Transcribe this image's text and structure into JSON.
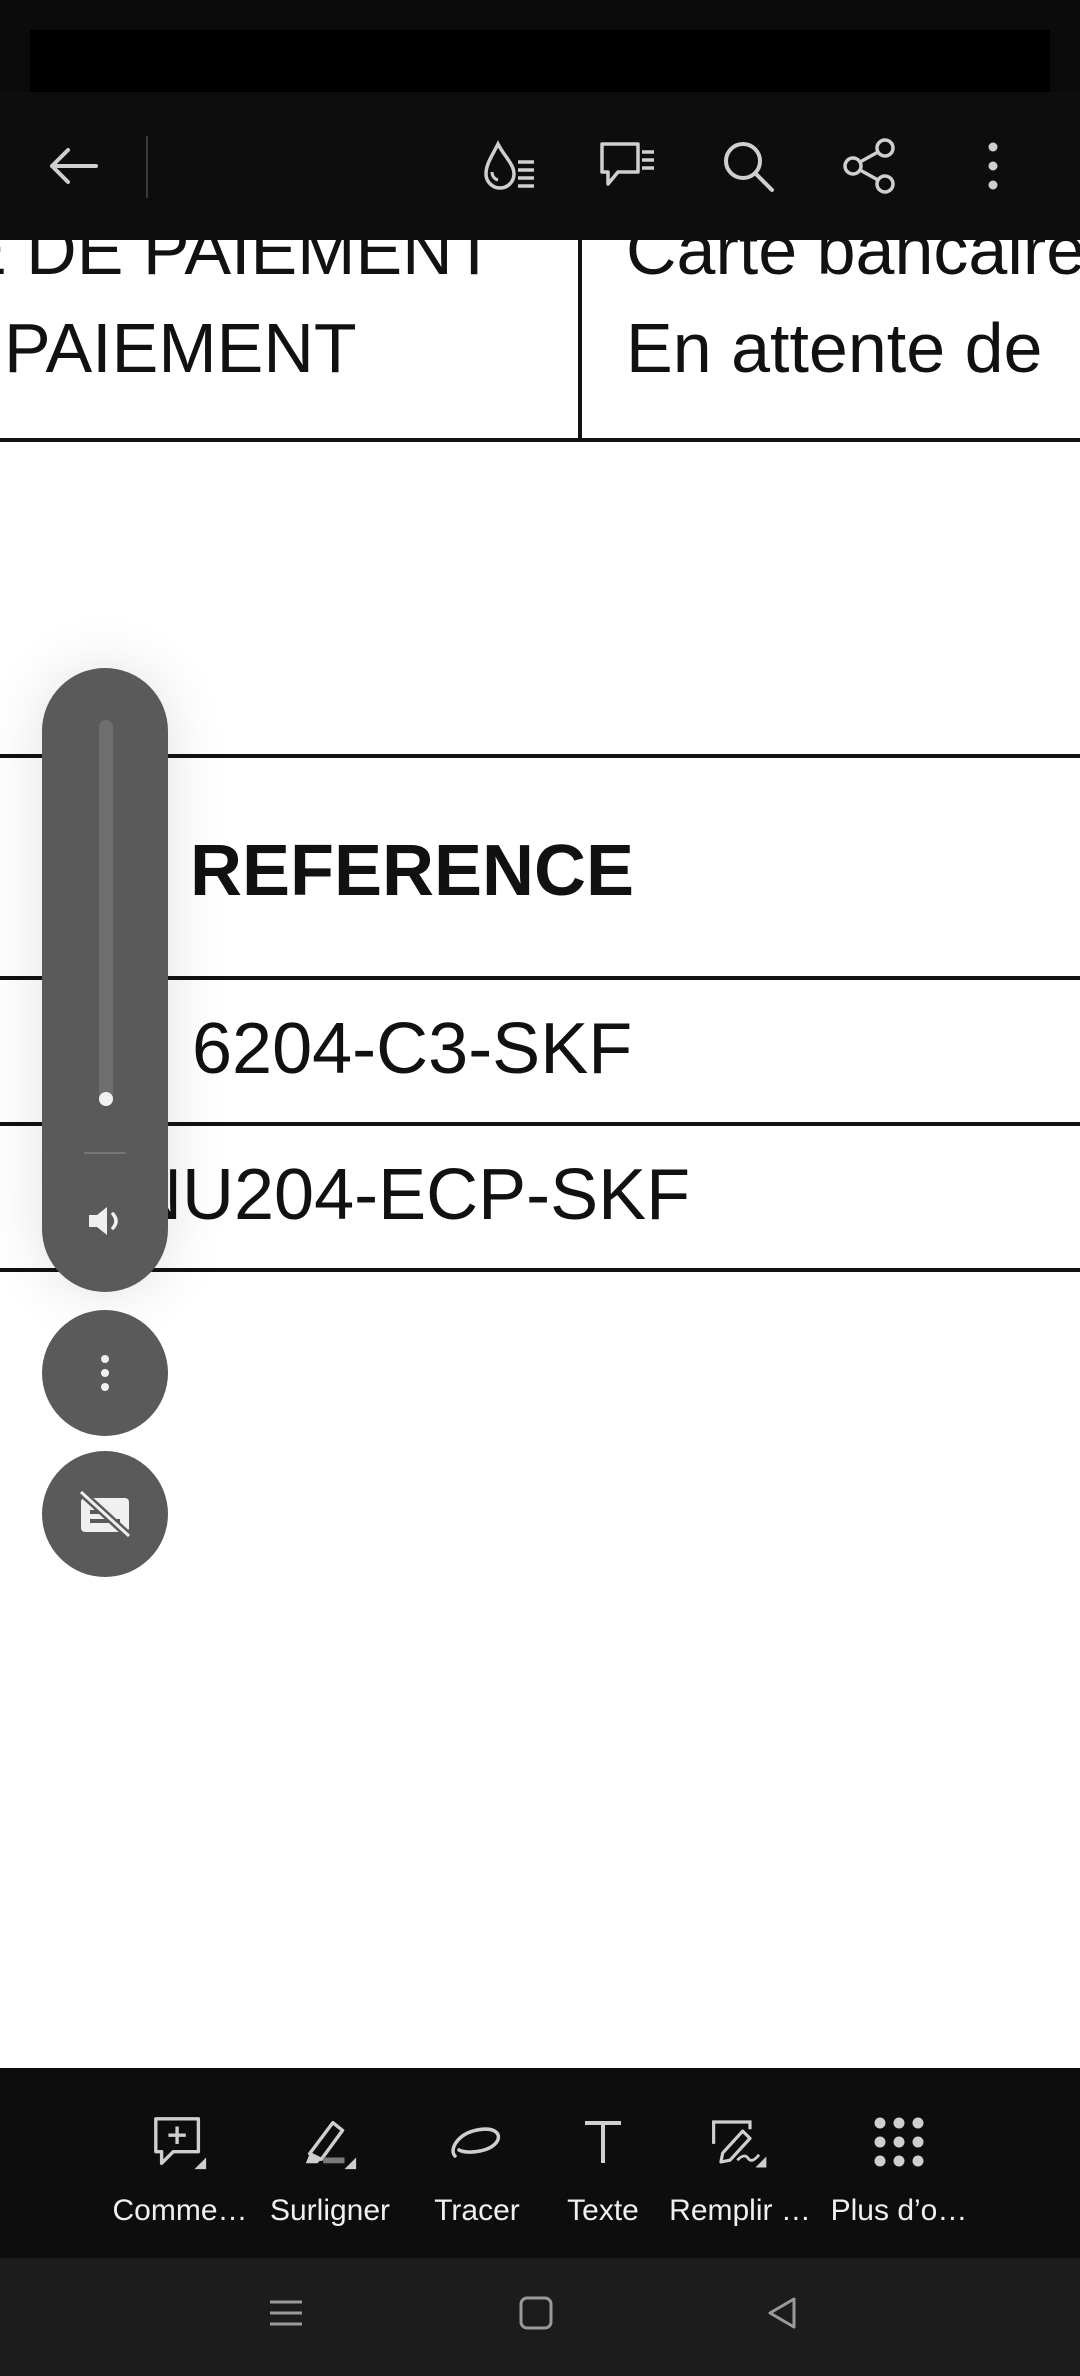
{
  "toolbar": {
    "back_icon": "arrow-left-icon",
    "icons": [
      "liquid-mode-icon",
      "comments-icon",
      "search-icon",
      "share-icon",
      "more-vertical-icon"
    ]
  },
  "document": {
    "row1_left_partial": "E DE PAIEMENT",
    "row1_right_partial": "Carte bancaire",
    "row2_left": "PAIEMENT",
    "row2_right": "En attente de",
    "header": "REFERENCE",
    "items": [
      "6204-C3-SKF",
      "NU204-ECP-SKF"
    ]
  },
  "floating": {
    "volume_icon": "volume-icon",
    "more_icon": "more-vertical-icon",
    "captions_icon": "captions-off-icon"
  },
  "bottom_tools": [
    {
      "label": "Comme…",
      "icon": "comment-add-icon"
    },
    {
      "label": "Surligner",
      "icon": "highlighter-icon"
    },
    {
      "label": "Tracer",
      "icon": "draw-icon"
    },
    {
      "label": "Texte",
      "icon": "text-icon"
    },
    {
      "label": "Remplir …",
      "icon": "fill-sign-icon"
    },
    {
      "label": "Plus d’o…",
      "icon": "grid-icon"
    }
  ],
  "navbar": {
    "icons": [
      "recents-icon",
      "home-icon",
      "back-icon"
    ]
  },
  "colors": {
    "toolbar": "#0d0d0d",
    "page": "#ffffff",
    "floating": "#5a5a5a"
  }
}
